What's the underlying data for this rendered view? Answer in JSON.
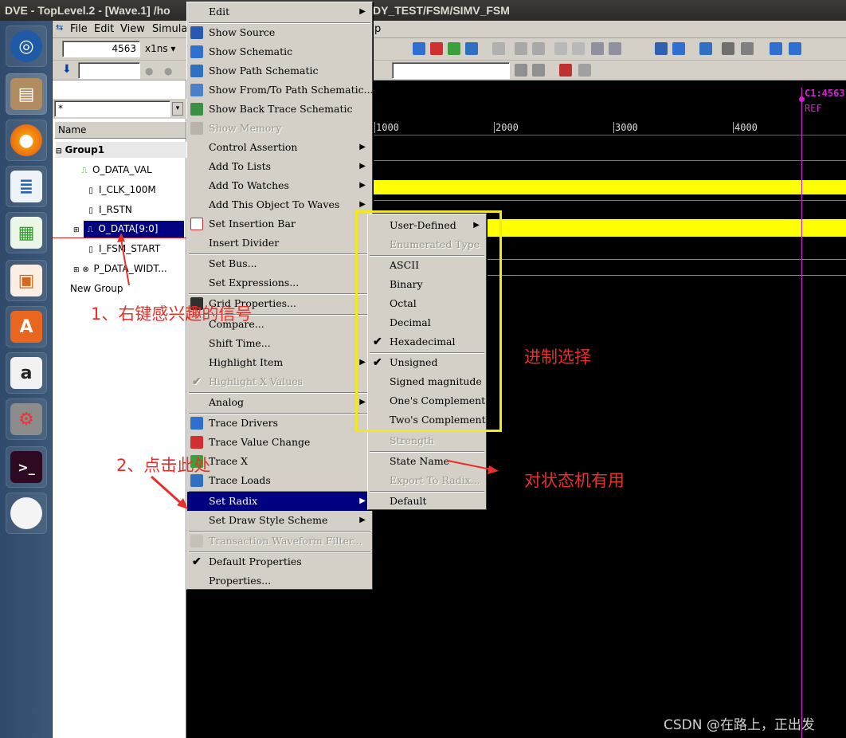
{
  "window": {
    "title_left": "DVE - TopLevel.2 - [Wave.1]  /ho",
    "title_right": "DY_TEST/FSM/SIMV_FSM"
  },
  "menubar": {
    "items": [
      "File",
      "Edit",
      "View",
      "Simulat"
    ],
    "trailing": "p"
  },
  "toolbar": {
    "time_value": "4563",
    "time_unit": "x1ns"
  },
  "filter": {
    "value": "*"
  },
  "signal_panel": {
    "header": "Name",
    "group": "Group1",
    "signals": [
      {
        "label": "O_DATA_VAL",
        "icon": "pulse-icon"
      },
      {
        "label": "I_CLK_100M",
        "icon": "bit-icon"
      },
      {
        "label": "I_RSTN",
        "icon": "bit-icon"
      },
      {
        "label": "O_DATA[9:0]",
        "icon": "bus-icon"
      },
      {
        "label": "I_FSM_START",
        "icon": "bit-icon"
      },
      {
        "label": "P_DATA_WIDT...",
        "icon": "param-icon"
      }
    ],
    "new_group": "New Group"
  },
  "wave": {
    "ticks": [
      "1000",
      "2000",
      "3000",
      "4000"
    ],
    "cursor_label": "C1:4563",
    "cursor_ref": "REF"
  },
  "context_menu": {
    "items": [
      {
        "label": "Edit",
        "submenu": true
      },
      {
        "label": "Show Source",
        "icon": "source-icon"
      },
      {
        "label": "Show Schematic",
        "icon": "schematic-icon"
      },
      {
        "label": "Show Path Schematic",
        "icon": "path-schematic-icon"
      },
      {
        "label": "Show From/To Path Schematic...",
        "icon": "fromto-icon"
      },
      {
        "label": "Show Back Trace Schematic",
        "icon": "backtrace-icon"
      },
      {
        "label": "Show Memory",
        "disabled": true,
        "icon": "memory-icon"
      },
      {
        "label": "Control Assertion",
        "submenu": true
      },
      {
        "label": "Add To Lists",
        "submenu": true
      },
      {
        "label": "Add To Watches",
        "submenu": true
      },
      {
        "label": "Add This Object To Waves",
        "submenu": true
      },
      {
        "label": "Set Insertion Bar",
        "icon": "insertion-icon"
      },
      {
        "label": "Insert Divider"
      },
      {
        "label": "Set Bus..."
      },
      {
        "label": "Set Expressions..."
      },
      {
        "label": "Grid Properties...",
        "icon": "grid-icon"
      },
      {
        "label": "Compare..."
      },
      {
        "label": "Shift Time..."
      },
      {
        "label": "Highlight Item",
        "submenu": true
      },
      {
        "label": "Highlight X Values",
        "disabled": true,
        "checked": true
      },
      {
        "label": "Analog",
        "submenu": true
      },
      {
        "label": "Trace Drivers",
        "icon": "trace-drivers-icon"
      },
      {
        "label": "Trace Value Change",
        "icon": "trace-value-icon"
      },
      {
        "label": "Trace X",
        "icon": "trace-x-icon"
      },
      {
        "label": "Trace Loads",
        "icon": "trace-loads-icon"
      },
      {
        "label": "Set Radix",
        "submenu": true,
        "selected": true
      },
      {
        "label": "Set Draw Style Scheme",
        "submenu": true
      },
      {
        "label": "Transaction Waveform Filter...",
        "disabled": true,
        "icon": "filter-icon"
      },
      {
        "label": "Default Properties",
        "checked": true
      },
      {
        "label": "Properties..."
      }
    ]
  },
  "radix_menu": {
    "items": [
      {
        "label": "User-Defined",
        "submenu": true
      },
      {
        "label": "Enumerated Type",
        "disabled": true
      },
      {
        "label": "ASCII"
      },
      {
        "label": "Binary"
      },
      {
        "label": "Octal"
      },
      {
        "label": "Decimal"
      },
      {
        "label": "Hexadecimal",
        "checked": true
      },
      {
        "label": "Unsigned",
        "checked": true
      },
      {
        "label": "Signed magnitude"
      },
      {
        "label": "One's Complement"
      },
      {
        "label": "Two's Complement"
      },
      {
        "label": "Strength",
        "disabled": true
      },
      {
        "label": "State Name"
      },
      {
        "label": "Export To Radix...",
        "disabled": true
      },
      {
        "label": "Default"
      }
    ]
  },
  "annotations": {
    "step1": "1、右键感兴趣的信号",
    "step2": "2、点击此处",
    "radix_note": "进制选择",
    "fsm_note": "对状态机有用",
    "watermark": "CSDN @在路上，正出发"
  },
  "colors": {
    "menu_selected": "#000080",
    "annotation_red": "#e8302a",
    "highlight_yellow": "#f5e81a",
    "cursor_magenta": "#d020d0",
    "wave_yellow": "#ffff00",
    "wave_green": "#20b020"
  }
}
